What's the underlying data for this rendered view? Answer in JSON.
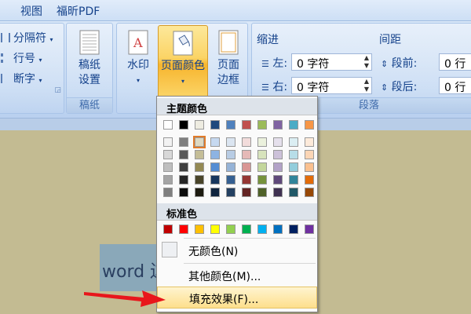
{
  "tabs": [
    "视图",
    "福昕PDF"
  ],
  "page_setup": {
    "columns_label": "分隔符",
    "line_numbers_label": "行号",
    "hyphenation_label": "断字"
  },
  "manuscript": {
    "button_line1": "稿纸",
    "button_line2": "设置",
    "group_label": "稿纸"
  },
  "page_background": {
    "watermark_label": "水印",
    "page_color_label": "页面颜色",
    "page_border_line1": "页面",
    "page_border_line2": "边框"
  },
  "paragraph": {
    "indent_header": "缩进",
    "spacing_header": "间距",
    "left_label": "左:",
    "right_label": "右:",
    "left_value": "0 字符",
    "right_value": "0 字符",
    "before_label": "段前:",
    "after_label": "段后:",
    "before_value": "0 行",
    "after_value": "0 行",
    "group_label": "段落"
  },
  "document": {
    "text": "word 边"
  },
  "dropdown": {
    "theme_header": "主题颜色",
    "standard_header": "标准色",
    "no_color": "无颜色(N)",
    "more_colors": "其他颜色(M)...",
    "fill_effects": "填充效果(F)...",
    "theme_colors": [
      [
        "#ffffff",
        "#f2f2f2",
        "#d8d8d8",
        "#bfbfbf",
        "#a5a5a5",
        "#7f7f7f"
      ],
      [
        "#000000",
        "#7f7f7f",
        "#595959",
        "#3f3f3f",
        "#262626",
        "#0c0c0c"
      ],
      [
        "#eeece1",
        "#ddd9c3",
        "#c4bd97",
        "#938953",
        "#494429",
        "#1d1b10"
      ],
      [
        "#1f497d",
        "#c6d9f0",
        "#8db3e2",
        "#548dd4",
        "#17365d",
        "#0f243e"
      ],
      [
        "#4f81bd",
        "#dbe5f1",
        "#b8cce4",
        "#95b3d7",
        "#366092",
        "#244061"
      ],
      [
        "#c0504d",
        "#f2dcdb",
        "#e5b9b7",
        "#d99694",
        "#953734",
        "#632423"
      ],
      [
        "#9bbb59",
        "#ebf1dd",
        "#d7e3bc",
        "#c3d69b",
        "#76923c",
        "#4f6128"
      ],
      [
        "#8064a2",
        "#e5e0ec",
        "#ccc1d9",
        "#b2a2c7",
        "#5f497a",
        "#3f3151"
      ],
      [
        "#4bacc6",
        "#dbeef3",
        "#b7dde8",
        "#92cddc",
        "#31859b",
        "#205867"
      ],
      [
        "#f79646",
        "#fdeada",
        "#fbd5b5",
        "#fac08f",
        "#e36c09",
        "#974806"
      ]
    ],
    "standard_colors": [
      "#c00000",
      "#ff0000",
      "#ffc000",
      "#ffff00",
      "#92d050",
      "#00b050",
      "#00b0f0",
      "#0070c0",
      "#002060",
      "#7030a0"
    ],
    "selected_theme_swatch": [
      2,
      1
    ]
  },
  "colors": {
    "accent_orange": "#f7b52e",
    "arrow_red": "#e8161b"
  }
}
